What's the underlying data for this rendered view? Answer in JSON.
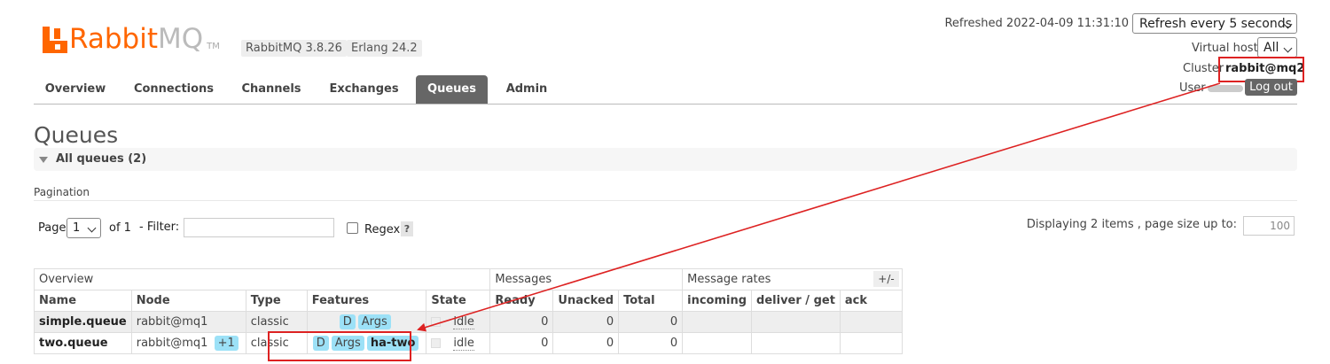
{
  "brand": {
    "name_rabbit": "Rabbit",
    "name_mq": "MQ",
    "tm": "TM"
  },
  "versions": {
    "rabbitmq": "RabbitMQ 3.8.26",
    "erlang": "Erlang 24.2"
  },
  "header": {
    "refreshed_label": "Refreshed 2022-04-09 11:31:10",
    "refresh_select": "Refresh every 5 seconds",
    "vhost_label": "Virtual host",
    "vhost_select": "All",
    "cluster_label": "Cluster",
    "cluster_value": "rabbit@mq2",
    "user_label": "User",
    "logout": "Log out"
  },
  "nav": {
    "tabs": [
      "Overview",
      "Connections",
      "Channels",
      "Exchanges",
      "Queues",
      "Admin"
    ],
    "active": "Queues"
  },
  "page": {
    "title": "Queues",
    "section": "All queues (2)",
    "pagination_title": "Pagination",
    "page_label": "Page",
    "page_value": "1",
    "of_label": "of 1",
    "filter_label": "- Filter:",
    "filter_value": "",
    "regex_label": "Regex",
    "help": "?",
    "displaying": "Displaying 2 items , page size up to:",
    "page_size": "100",
    "plus_minus": "+/-"
  },
  "table": {
    "groups": [
      "Overview",
      "Messages",
      "Message rates"
    ],
    "columns": [
      "Name",
      "Node",
      "Type",
      "Features",
      "State",
      "Ready",
      "Unacked",
      "Total",
      "incoming",
      "deliver / get",
      "ack"
    ],
    "rows": [
      {
        "name": "simple.queue",
        "node": "rabbit@mq1",
        "node_extra": "",
        "type": "classic",
        "features": [
          "D",
          "Args"
        ],
        "state": "idle",
        "ready": "0",
        "unacked": "0",
        "total": "0",
        "incoming": "",
        "deliver_get": "",
        "ack": ""
      },
      {
        "name": "two.queue",
        "node": "rabbit@mq1",
        "node_extra": "+1",
        "type": "classic",
        "features": [
          "D",
          "Args",
          "ha-two"
        ],
        "state": "idle",
        "ready": "0",
        "unacked": "0",
        "total": "0",
        "incoming": "",
        "deliver_get": "",
        "ack": ""
      }
    ]
  },
  "colors": {
    "accent": "#ff6600",
    "feature_tag": "#9ce1f7",
    "annotation": "#dd2222",
    "nav_active": "#666666"
  }
}
